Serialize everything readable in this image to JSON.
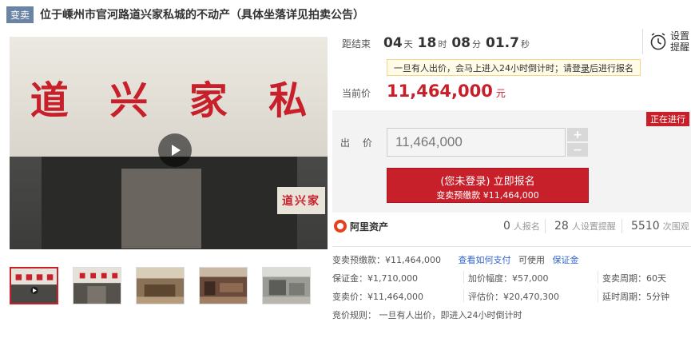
{
  "header": {
    "tag": "变卖",
    "title": "位于嵊州市官河路道兴家私城的不动产（具体坐落详见拍卖公告）"
  },
  "gallery": {
    "sign_chars": [
      "道",
      "兴",
      "家",
      "私"
    ],
    "side_sign": "道兴家",
    "thumbnail_count": 5
  },
  "countdown": {
    "label": "距结束",
    "days": "04",
    "days_unit": "天",
    "hours": "18",
    "hours_unit": "时",
    "minutes": "08",
    "minutes_unit": "分",
    "seconds": "01.7",
    "seconds_unit": "秒"
  },
  "remind": {
    "label": "设置提醒"
  },
  "notice": {
    "text": "一旦有人出价，会马上进入24小时倒计时；请登",
    "link": "录",
    "text_after": "后进行报名"
  },
  "price": {
    "label": "当前价",
    "value": "11,464,000",
    "unit": "元"
  },
  "bid": {
    "status_badge": "正在进行",
    "label": "出 价",
    "input_value": "11,464,000",
    "plus": "+",
    "minus": "−",
    "signup_main": "(您未登录) 立即报名",
    "signup_sub": "变卖预缴款 ¥11,464,000"
  },
  "stats": {
    "brand": "阿里资产",
    "registrations": {
      "num": "0",
      "label": "人报名"
    },
    "reminders": {
      "num": "28",
      "label": "人设置提醒"
    },
    "views": {
      "num": "5510",
      "label": "次围观"
    }
  },
  "info": {
    "deposit_label": "变卖预缴款：¥11,464,000",
    "deposit_link": "查看如何支付",
    "deposit_note": "可使用",
    "deposit_loan": "保证金",
    "bond": "保证金：¥1,710,000",
    "increment": "加价幅度：¥57,000",
    "period": "变卖周期：60天",
    "sale_price": "变卖价：¥11,464,000",
    "appraisal": "评估价：¥20,470,300",
    "delay": "延时周期：5分钟",
    "rule": "竞价规则：   一旦有人出价，即进入24小时倒计时"
  },
  "colors": {
    "accent": "#c8202a",
    "tag_bg": "#6b84a6",
    "link": "#3366cc"
  }
}
